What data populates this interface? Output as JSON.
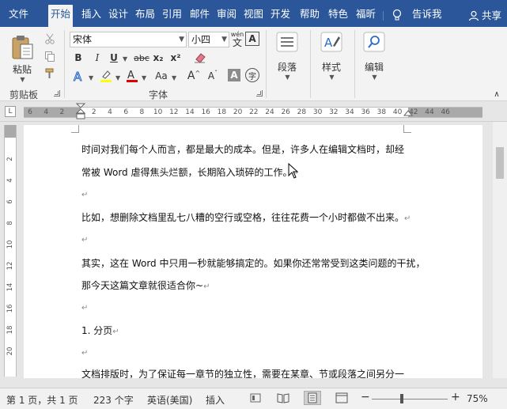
{
  "tabs": [
    {
      "label": "文件"
    },
    {
      "label": "开始"
    },
    {
      "label": "插入"
    },
    {
      "label": "设计"
    },
    {
      "label": "布局"
    },
    {
      "label": "引用"
    },
    {
      "label": "邮件"
    },
    {
      "label": "审阅"
    },
    {
      "label": "视图"
    },
    {
      "label": "开发"
    },
    {
      "label": "帮助"
    },
    {
      "label": "特色"
    },
    {
      "label": "福昕"
    }
  ],
  "tellme": "告诉我",
  "share": "共享",
  "ribbon": {
    "paste": "粘贴",
    "clipboard_group": "剪贴板",
    "font_name": "宋体",
    "font_size": "小四",
    "font_group": "字体",
    "paragraph": "段落",
    "styles": "样式",
    "editing": "编辑",
    "bold": "B",
    "italic": "I",
    "underline": "U",
    "strike": "abc",
    "subscript": "x₂",
    "superscript": "x²",
    "case": "Aa",
    "grow": "A",
    "shrink": "A",
    "char_border": "A",
    "phonetic": "wén",
    "enclose": "字"
  },
  "ruler_numbers": [
    "6",
    "4",
    "2",
    "",
    "2",
    "4",
    "6",
    "8",
    "10",
    "12",
    "14",
    "16",
    "18",
    "20",
    "22",
    "24",
    "26",
    "28",
    "30",
    "32",
    "34",
    "36",
    "38",
    "40",
    "42",
    "44",
    "46"
  ],
  "vruler_numbers": [
    "2",
    "4",
    "6",
    "8",
    "10",
    "12",
    "14",
    "16",
    "18",
    "20"
  ],
  "document": {
    "lines": [
      "时间对我们每个人而言，都是最大的成本。但是，许多人在编辑文档时，却经",
      "常被 Word 虐得焦头烂额，长期陷入琐碎的工作。",
      "",
      "比如，想删除文档里乱七八糟的空行或空格，往往花费一个小时都做不出来。",
      "",
      "其实，这在 Word 中只用一秒就能够搞定的。如果你还常常受到这类问题的干扰，",
      "那今天这篇文章就很适合你~",
      "",
      "1.  分页",
      "",
      "文档排版时，为了保证每一章节的独立性，需要在某章、节或段落之间另分一"
    ]
  },
  "status": {
    "page": "第 1 页，共 1 页",
    "words": "223 个字",
    "language": "英语(美国)",
    "mode": "插入",
    "zoom": "75%"
  }
}
